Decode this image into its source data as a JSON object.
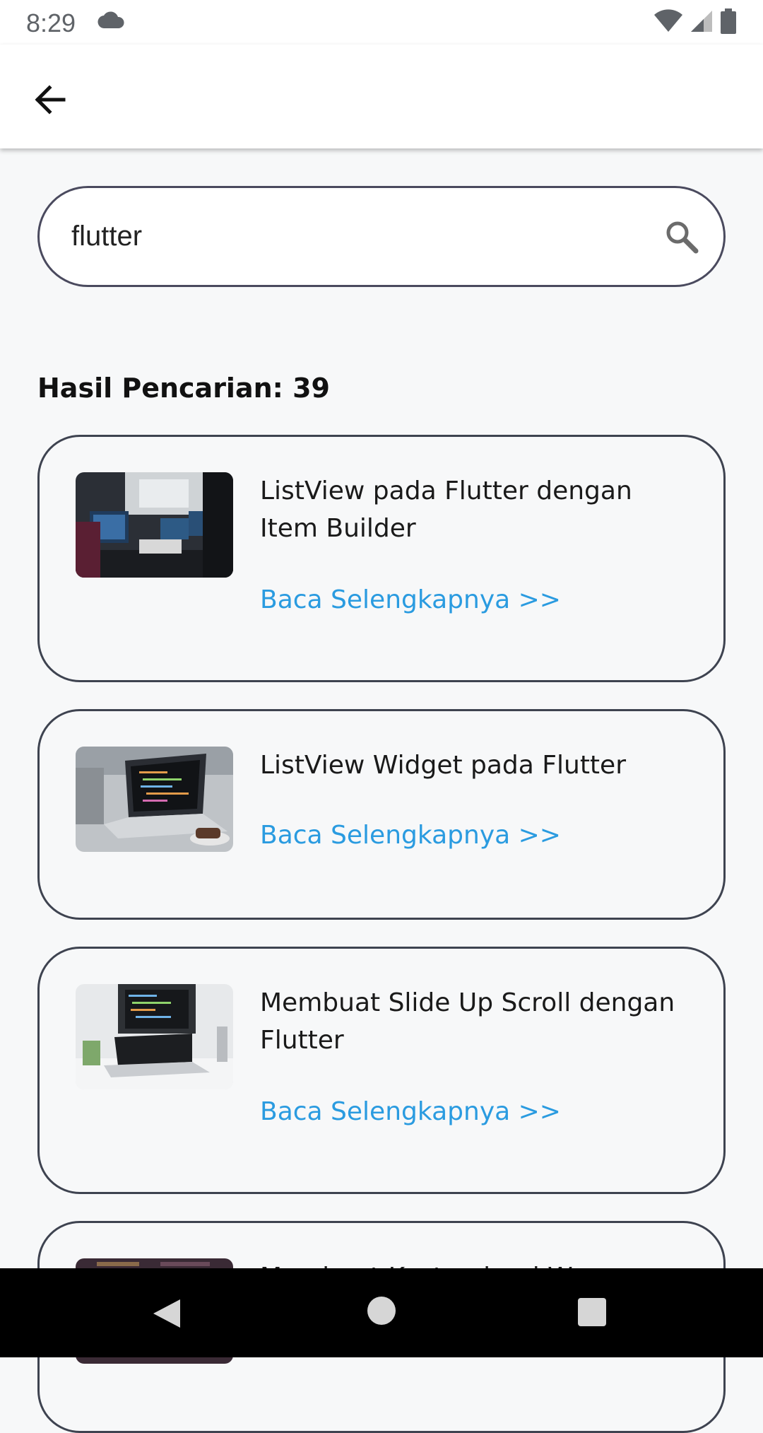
{
  "status_bar": {
    "time": "8:29",
    "icons": [
      "cloud-icon",
      "wifi-icon",
      "cellular-signal-icon",
      "battery-icon"
    ]
  },
  "app_bar": {
    "back_icon": "arrow-left-icon"
  },
  "search": {
    "value": "flutter",
    "icon": "search-icon"
  },
  "results": {
    "title": "Hasil Pencarian: 39",
    "items": [
      {
        "title": "ListView pada Flutter dengan Item Builder",
        "link": "Baca Selengkapnya >>",
        "thumbnail": "office-monitors-photo"
      },
      {
        "title": "ListView Widget pada Flutter",
        "link": "Baca Selengkapnya >>",
        "thumbnail": "laptop-code-photo"
      },
      {
        "title": "Membuat Slide Up Scroll dengan Flutter",
        "link": "Baca Selengkapnya >>",
        "thumbnail": "desk-laptop-photo"
      },
      {
        "title": "Membuat Kustomisasi W",
        "link": "",
        "thumbnail": "dark-room-photo"
      }
    ]
  },
  "colors": {
    "link": "#2a9be0",
    "card_border": "#3e4350",
    "background": "#f7f8f9"
  },
  "nav_bar": {
    "icons": [
      "nav-back-icon",
      "nav-home-icon",
      "nav-recents-icon"
    ]
  }
}
